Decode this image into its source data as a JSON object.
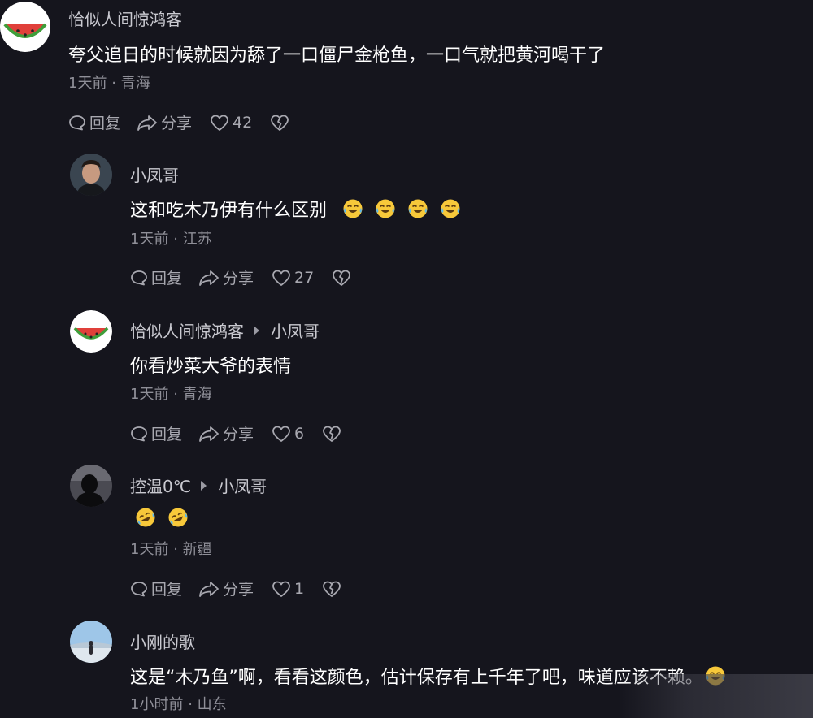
{
  "comments": [
    {
      "username": "恰似人间惊鸿客",
      "text": "夸父追日的时候就因为舔了一口僵尸金枪鱼，一口气就把黄河喝干了",
      "time": "1天前",
      "location": "青海",
      "reply_label": "回复",
      "share_label": "分享",
      "likes": "42",
      "avatar": "watermelon-avatar"
    },
    {
      "username": "小凤哥",
      "text": "这和吃木乃伊有什么区别",
      "emoji_count": 4,
      "time": "1天前",
      "location": "江苏",
      "reply_label": "回复",
      "share_label": "分享",
      "likes": "27",
      "avatar": "man-portrait-avatar"
    },
    {
      "username": "恰似人间惊鸿客",
      "reply_to": "小凤哥",
      "text": "你看炒菜大爷的表情",
      "time": "1天前",
      "location": "青海",
      "reply_label": "回复",
      "share_label": "分享",
      "likes": "6",
      "avatar": "watermelon-avatar"
    },
    {
      "username": "控温0℃",
      "reply_to": "小凤哥",
      "text": "",
      "emoji_count": 2,
      "time": "1天前",
      "location": "新疆",
      "reply_label": "回复",
      "share_label": "分享",
      "likes": "1",
      "avatar": "dark-silhouette-avatar"
    },
    {
      "username": "小刚的歌",
      "text": "这是“木乃鱼”啊，看看这颜色，估计保存有上千年了吧，味道应该不赖。",
      "emoji_count": 1,
      "time": "1小时前",
      "location": "山东",
      "avatar": "landscape-avatar"
    }
  ],
  "colors": {
    "background": "#15151d",
    "primary_text": "#ffffff",
    "secondary_text": "#8f8f98",
    "emoji_face": "#f7c83a"
  }
}
